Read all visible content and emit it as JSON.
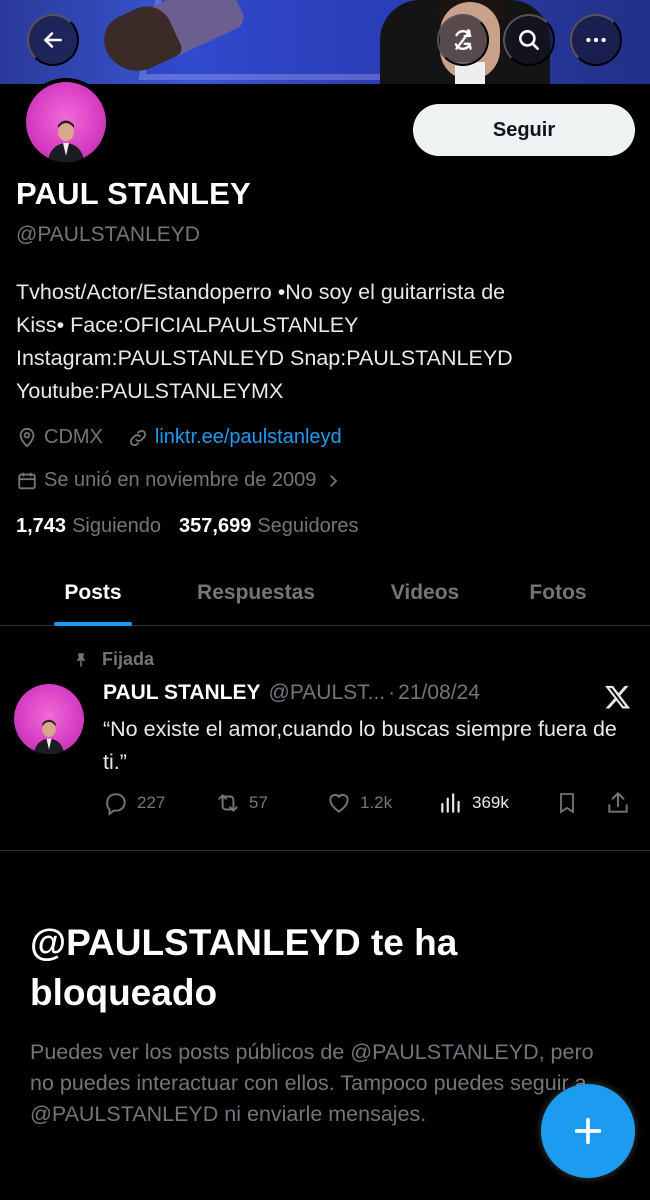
{
  "header": {
    "back_icon": "arrow-left-icon",
    "sync_icon": "sync-off-icon",
    "search_icon": "search-icon",
    "more_icon": "more-horizontal-icon"
  },
  "profile": {
    "name": "PAUL STANLEY",
    "handle": "@PAULSTANLEYD",
    "follow_label": "Seguir",
    "bio_lines": [
      "Tvhost/Actor/Estandoperro •No soy el guitarrista de",
      "Kiss• Face:OFICIALPAULSTANLEY",
      "Instagram:PAULSTANLEYD Snap:PAULSTANLEYD",
      "Youtube:PAULSTANLEYMX"
    ],
    "location": "CDMX",
    "link": "linktr.ee/paulstanleyd",
    "joined": "Se unió en noviembre de 2009",
    "following_count": "1,743",
    "following_label": "Siguiendo",
    "followers_count": "357,699",
    "followers_label": "Seguidores"
  },
  "tabs": [
    {
      "label": "Posts",
      "active": true
    },
    {
      "label": "Respuestas",
      "active": false
    },
    {
      "label": "Videos",
      "active": false
    },
    {
      "label": "Fotos",
      "active": false
    }
  ],
  "pinned_post": {
    "pinned_label": "Fijada",
    "author_name": "PAUL STANLEY",
    "author_handle": "@PAULST...",
    "separator": "·",
    "date": "21/08/24",
    "text": "“No existe el amor,cuando lo buscas siempre fuera de ti.”",
    "replies": "227",
    "reposts": "57",
    "likes": "1.2k",
    "views": "369k"
  },
  "blocked_notice": {
    "title": "@PAULSTANLEYD te ha bloqueado",
    "text": "Puedes ver los posts públicos de @PAULSTANLEYD, pero no puedes interactuar con ellos. Tampoco puedes seguir a @PAULSTANLEYD ni enviarle mensajes."
  },
  "colors": {
    "accent": "#1d9bf0",
    "background": "#000000",
    "muted_text": "#71767b",
    "avatar_bg": "#e04fcf"
  }
}
